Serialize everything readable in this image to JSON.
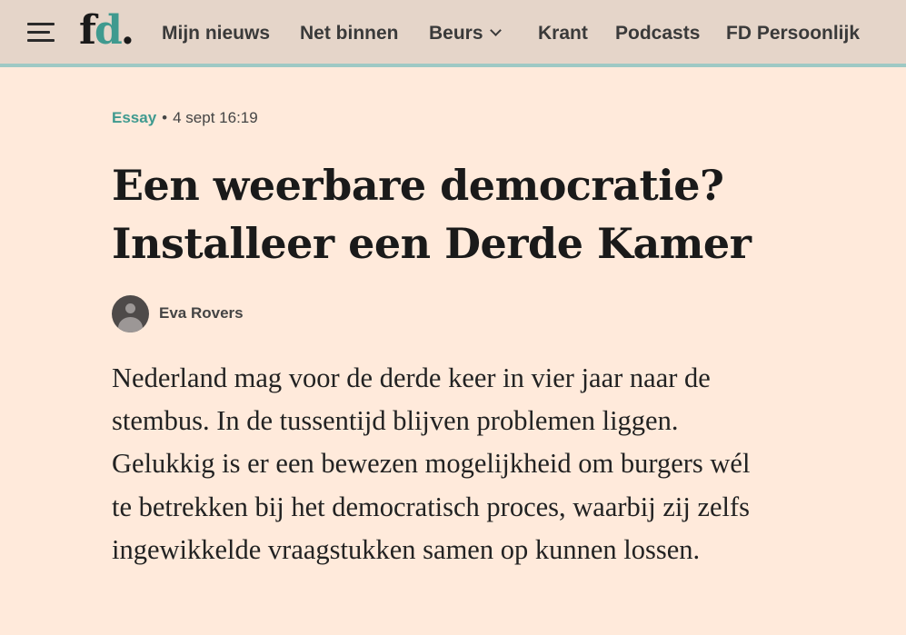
{
  "header": {
    "logo": {
      "f": "f",
      "d": "d",
      "dot": "."
    },
    "nav": [
      {
        "label": "Mijn nieuws"
      },
      {
        "label": "Net binnen"
      },
      {
        "label": "Beurs"
      },
      {
        "label": "Krant"
      },
      {
        "label": "Podcasts"
      },
      {
        "label": "FD Persoonlijk"
      }
    ],
    "menu_icon": "hamburger-icon",
    "dropdown_icon": "chevron-down-icon"
  },
  "article": {
    "section": "Essay",
    "separator": "•",
    "timestamp": "4 sept 16:19",
    "title_line1": "Een weerbare democratie?",
    "title_line2": "Installeer een Derde Kamer",
    "author": "Eva Rovers",
    "intro": "Nederland mag voor de derde keer in vier jaar naar de stembus. In de tussentijd blijven problemen liggen. Gelukkig is er een bewezen mogelijkheid om burgers wél te betrekken bij het democratisch proces, waarbij zij zelfs ingewikkelde vraagstukken samen op kunnen lossen."
  },
  "colors": {
    "background": "#ffeadb",
    "header": "#e5d5c9",
    "header_border": "#9ec9c4",
    "accent": "#3f9a8f"
  }
}
